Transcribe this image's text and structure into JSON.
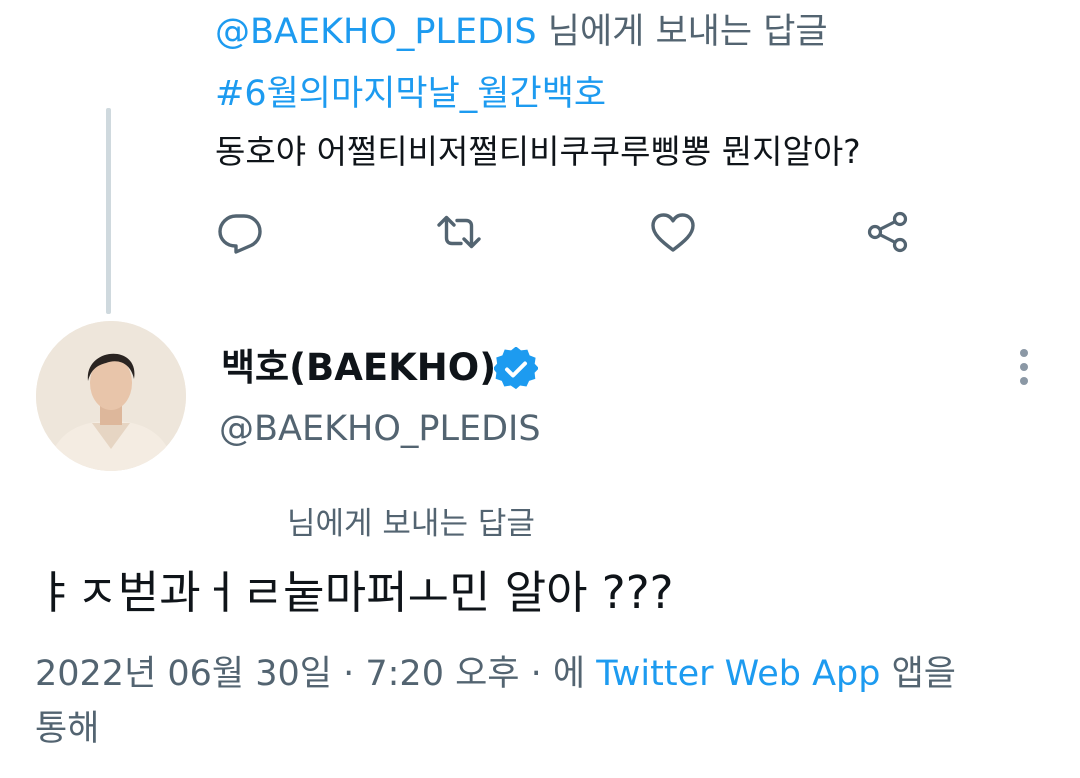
{
  "prev_tweet": {
    "reply_handle": "@BAEKHO_PLEDIS",
    "reply_suffix": "님에게 보내는 답글",
    "hashtag": "#6월의마지막날_월간백호",
    "text": "동호야 어쩔티비저쩔티비쿠쿠루삥뽕 뭔지알아?",
    "actions": [
      "reply-icon",
      "retweet-icon",
      "like-icon",
      "share-icon"
    ]
  },
  "main_tweet": {
    "display_name": "백호(BAEKHO)",
    "handle": "@BAEKHO_PLEDIS",
    "verified_icon": "verified-badge-icon",
    "more_icon": "more-vertical-icon",
    "reply_label": "님에게 보내는 답글",
    "text": "ㅑㅈ벋과ㅓㄹ눝마퍼ㅗ민 알아 ???",
    "timestamp": "2022년 06월 30일 · 7:20 오후 · 에",
    "source_app": "Twitter Web App",
    "source_suffix": "앱을",
    "source_suffix2": "통해"
  },
  "colors": {
    "accent": "#1d9bf0",
    "secondary_text": "#536471",
    "thread_line": "#cfd9de"
  }
}
